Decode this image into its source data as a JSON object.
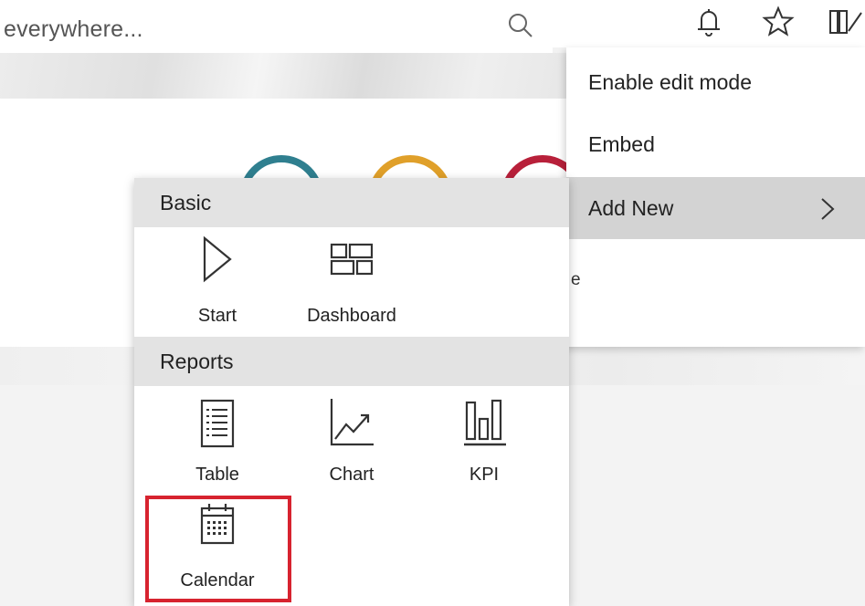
{
  "search": {
    "text": "everywhere..."
  },
  "background": {
    "fragment": "e"
  },
  "context_menu": {
    "items": [
      {
        "label": "Enable edit mode"
      },
      {
        "label": "Embed"
      },
      {
        "label": "Add New",
        "selected": true
      }
    ]
  },
  "submenu": {
    "sections": [
      {
        "title": "Basic",
        "items": [
          {
            "label": "Start",
            "icon": "play-triangle-icon"
          },
          {
            "label": "Dashboard",
            "icon": "dashboard-icon"
          }
        ]
      },
      {
        "title": "Reports",
        "items": [
          {
            "label": "Table",
            "icon": "table-icon"
          },
          {
            "label": "Chart",
            "icon": "chart-icon"
          },
          {
            "label": "KPI",
            "icon": "kpi-icon"
          },
          {
            "label": "Calendar",
            "icon": "calendar-icon",
            "highlighted": true
          }
        ]
      }
    ]
  },
  "colors": {
    "highlight": "#d7232f",
    "menu_selected": "#d3d3d3",
    "section_header": "#e3e3e3"
  }
}
